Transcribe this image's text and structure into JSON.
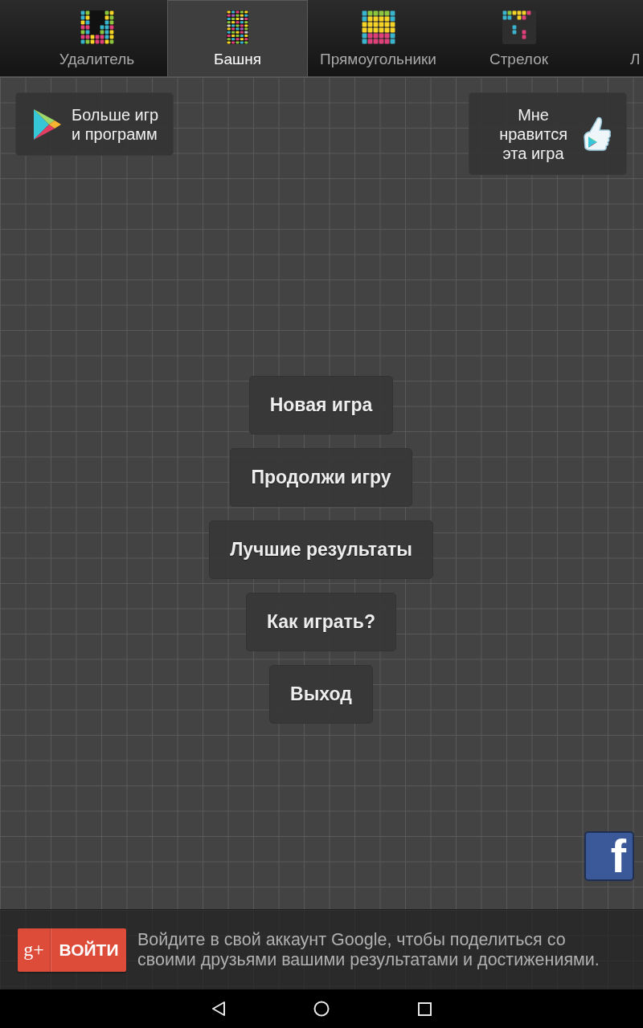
{
  "tabs": [
    {
      "label": "Удалитель",
      "selected": false
    },
    {
      "label": "Башня",
      "selected": true
    },
    {
      "label": "Прямоугольники",
      "selected": false
    },
    {
      "label": "Стрелок",
      "selected": false
    },
    {
      "label": "Л",
      "selected": false
    }
  ],
  "top_buttons": [
    {
      "kind": "store",
      "label": "Больше игр\nи программ"
    },
    {
      "kind": "like",
      "label": "Мне\nнравится\nэта игра"
    }
  ],
  "menu": [
    "Новая игра",
    "Продолжи игру",
    "Лучшие результаты",
    "Как играть?",
    "Выход"
  ],
  "facebook_button": {
    "label": "f"
  },
  "sign_in": {
    "logo": "g+",
    "button": "ВОЙТИ",
    "message": "Войдите в свой аккаунт Google, чтобы поделиться со\nсвоими друзьями вашими результатами и достижениями."
  }
}
